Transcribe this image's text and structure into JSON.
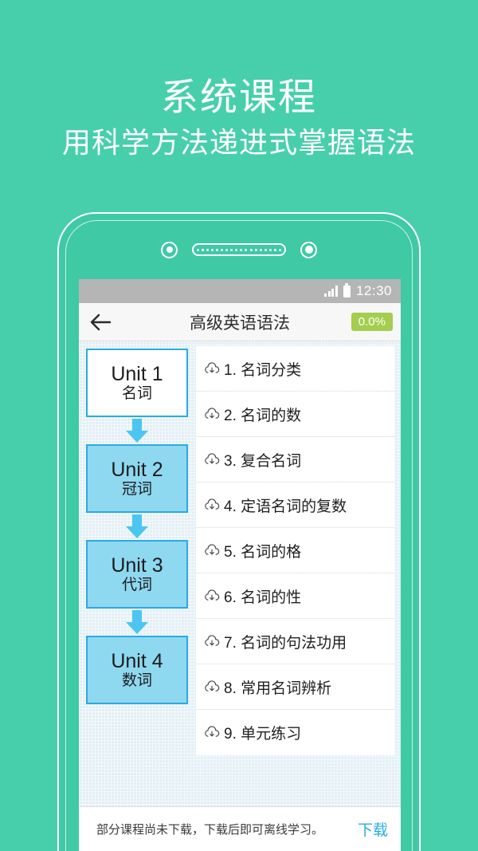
{
  "promo": {
    "title": "系统课程",
    "subtitle": "用科学方法递进式掌握语法"
  },
  "colors": {
    "background_green": "#47cfac",
    "phone_body_green": "#3fc9a5",
    "accent_blue": "#29abe2",
    "unit_fill_blue": "#8ed8f0",
    "badge_green": "#a3ce4e",
    "statusbar_gray": "#b5b5b5",
    "panel_bg": "#e3eff5"
  },
  "phone": {
    "bezel": {
      "camera_icon": "camera-icon",
      "speaker_icon": "speaker-grille-icon",
      "sensor_icon": "proximity-sensor-icon"
    }
  },
  "statusbar": {
    "signal_icon": "signal-bars-icon",
    "battery_icon": "battery-icon",
    "time": "12:30"
  },
  "appbar": {
    "back_icon": "back-arrow-icon",
    "title": "高级英语语法",
    "progress": "0.0%"
  },
  "units": [
    {
      "title": "Unit 1",
      "subtitle": "名词",
      "active": true
    },
    {
      "title": "Unit 2",
      "subtitle": "冠词",
      "active": false
    },
    {
      "title": "Unit 3",
      "subtitle": "代词",
      "active": false
    },
    {
      "title": "Unit 4",
      "subtitle": "数词",
      "active": false
    }
  ],
  "lessons": [
    {
      "icon": "cloud-download-icon",
      "label": "1. 名词分类"
    },
    {
      "icon": "cloud-download-icon",
      "label": "2. 名词的数"
    },
    {
      "icon": "cloud-download-icon",
      "label": "3. 复合名词"
    },
    {
      "icon": "cloud-download-icon",
      "label": "4. 定语名词的复数"
    },
    {
      "icon": "cloud-download-icon",
      "label": "5. 名词的格"
    },
    {
      "icon": "cloud-download-icon",
      "label": "6. 名词的性"
    },
    {
      "icon": "cloud-download-icon",
      "label": "7. 名词的句法功用"
    },
    {
      "icon": "cloud-download-icon",
      "label": "8. 常用名词辨析"
    },
    {
      "icon": "cloud-download-icon",
      "label": "9. 单元练习"
    }
  ],
  "bottombar": {
    "message": "部分课程尚未下载，下载后即可离线学习。",
    "action_label": "下载"
  }
}
